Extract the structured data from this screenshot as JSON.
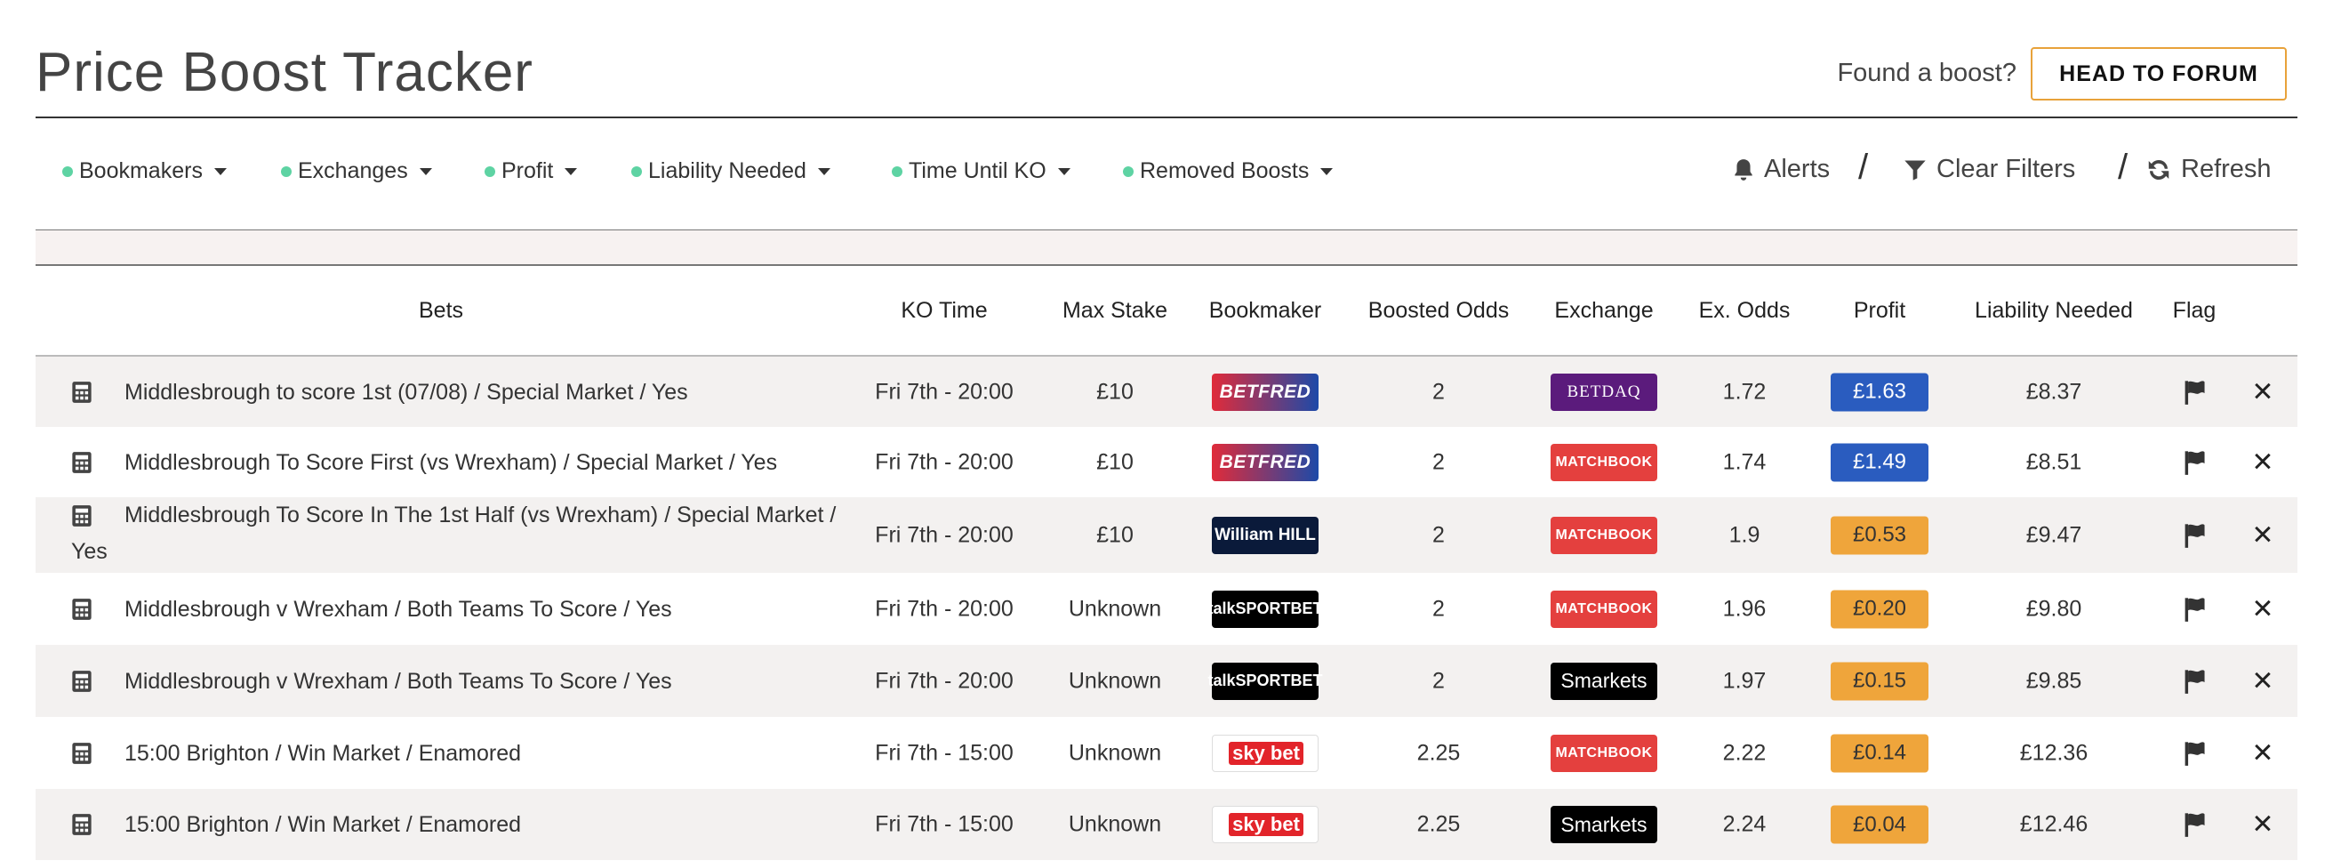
{
  "header": {
    "title": "Price Boost Tracker",
    "found_text": "Found a boost?",
    "forum_button": "HEAD TO FORUM"
  },
  "filters": [
    {
      "label": "Bookmakers"
    },
    {
      "label": "Exchanges"
    },
    {
      "label": "Profit"
    },
    {
      "label": "Liability Needed"
    },
    {
      "label": "Time Until KO"
    },
    {
      "label": "Removed Boosts"
    }
  ],
  "actions": {
    "alerts": "Alerts",
    "clear_filters": "Clear Filters",
    "refresh": "Refresh",
    "separator": "/"
  },
  "columns": {
    "bets": "Bets",
    "ko_time": "KO Time",
    "max_stake": "Max Stake",
    "bookmaker": "Bookmaker",
    "boosted_odds": "Boosted Odds",
    "exchange": "Exchange",
    "ex_odds": "Ex. Odds",
    "profit": "Profit",
    "liability": "Liability Needed",
    "flag": "Flag"
  },
  "rows": [
    {
      "bet": "Middlesbrough to score 1st (07/08) / Special Market / Yes",
      "ko": "Fri 7th - 20:00",
      "stake": "£10",
      "bookmaker": "BETFRED",
      "odds": "2",
      "exchange": "BETDAQ",
      "ex_odds": "1.72",
      "profit": "£1.63",
      "profit_tier": "blue",
      "liability": "£8.37"
    },
    {
      "bet": "Middlesbrough To Score First (vs Wrexham) / Special Market / Yes",
      "ko": "Fri 7th - 20:00",
      "stake": "£10",
      "bookmaker": "BETFRED",
      "odds": "2",
      "exchange": "MATCHBOOK",
      "ex_odds": "1.74",
      "profit": "£1.49",
      "profit_tier": "blue",
      "liability": "£8.51"
    },
    {
      "bet": "Middlesbrough To Score In The 1st Half (vs Wrexham) / Special Market / Yes",
      "ko": "Fri 7th - 20:00",
      "stake": "£10",
      "bookmaker": "William HILL",
      "odds": "2",
      "exchange": "MATCHBOOK",
      "ex_odds": "1.9",
      "profit": "£0.53",
      "profit_tier": "orange",
      "liability": "£9.47"
    },
    {
      "bet": "Middlesbrough v Wrexham / Both Teams To Score / Yes",
      "ko": "Fri 7th - 20:00",
      "stake": "Unknown",
      "bookmaker": "talkSPORTBET",
      "odds": "2",
      "exchange": "MATCHBOOK",
      "ex_odds": "1.96",
      "profit": "£0.20",
      "profit_tier": "orange",
      "liability": "£9.80"
    },
    {
      "bet": "Middlesbrough v Wrexham / Both Teams To Score / Yes",
      "ko": "Fri 7th - 20:00",
      "stake": "Unknown",
      "bookmaker": "talkSPORTBET",
      "odds": "2",
      "exchange": "Smarkets",
      "ex_odds": "1.97",
      "profit": "£0.15",
      "profit_tier": "orange",
      "liability": "£9.85"
    },
    {
      "bet": "15:00 Brighton / Win Market / Enamored",
      "ko": "Fri 7th - 15:00",
      "stake": "Unknown",
      "bookmaker": "sky bet",
      "odds": "2.25",
      "exchange": "MATCHBOOK",
      "ex_odds": "2.22",
      "profit": "£0.14",
      "profit_tier": "orange",
      "liability": "£12.36"
    },
    {
      "bet": "15:00 Brighton / Win Market / Enamored",
      "ko": "Fri 7th - 15:00",
      "stake": "Unknown",
      "bookmaker": "sky bet",
      "odds": "2.25",
      "exchange": "Smarkets",
      "ex_odds": "2.24",
      "profit": "£0.04",
      "profit_tier": "orange",
      "liability": "£12.46"
    }
  ],
  "colors": {
    "accent_green": "#5ed3a3",
    "forum_border": "#e8a23a",
    "profit_blue": "#2a5cbf",
    "profit_orange": "#efa53b"
  },
  "icons": [
    "bell-icon",
    "filter-icon",
    "refresh-icon",
    "calculator-icon",
    "flag-icon",
    "close-icon",
    "caret-down-icon"
  ]
}
